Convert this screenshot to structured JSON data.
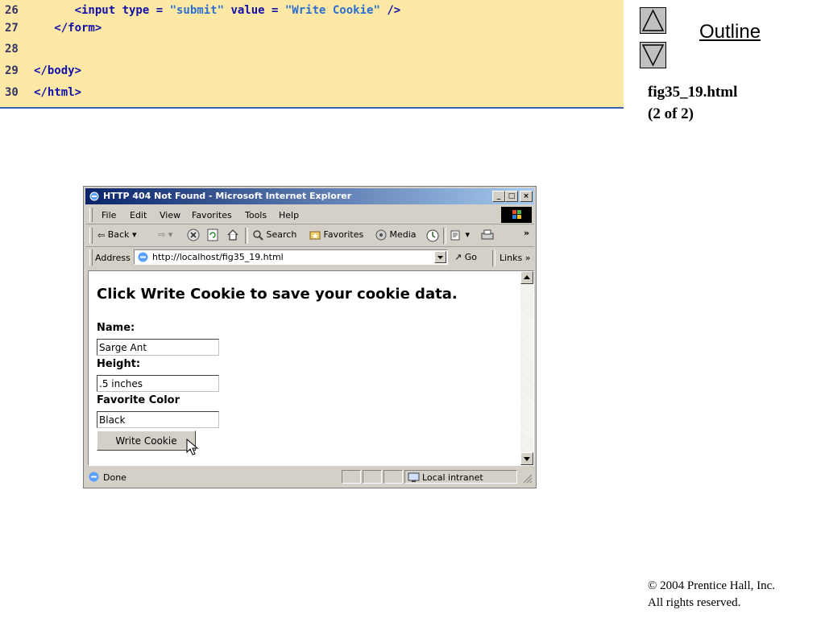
{
  "code": {
    "lines": [
      {
        "num": "26",
        "pre": "      <input type = ",
        "s1": "\"submit\"",
        "mid": " value = ",
        "s2": "\"Write Cookie\"",
        "post": " />"
      },
      {
        "num": "27",
        "text": "   </form>"
      },
      {
        "num": "28",
        "text": ""
      },
      {
        "num": "29",
        "text": "</body>"
      },
      {
        "num": "30",
        "text": "</html>"
      }
    ]
  },
  "outline": {
    "label": "Outline",
    "caption_line1": "fig35_19.html",
    "caption_line2": "(2 of 2)"
  },
  "footer": {
    "copyright_line1": "© 2004 Prentice Hall, Inc.",
    "copyright_line2": "All rights reserved."
  },
  "browser": {
    "title": "HTTP 404 Not Found - Microsoft Internet Explorer",
    "menu": [
      "File",
      "Edit",
      "View",
      "Favorites",
      "Tools",
      "Help"
    ],
    "toolbar": {
      "back": "Back",
      "search": "Search",
      "favorites": "Favorites",
      "media": "Media",
      "more": "»"
    },
    "address_label": "Address",
    "address_value": "http://localhost/fig35_19.html",
    "go_label": "Go",
    "links_label": "Links »",
    "status_text": "Done",
    "zone_text": "Local intranet"
  },
  "page": {
    "heading": "Click Write Cookie to save your cookie data.",
    "name_label": "Name:",
    "name_value": "Sarge Ant",
    "height_label": "Height:",
    "height_value": ".5 inches",
    "color_label": "Favorite Color",
    "color_value": "Black",
    "button_label": "Write Cookie"
  },
  "colors": {
    "code_background": "#fde8a6",
    "code_text": "#1111aa",
    "code_string": "#2a6fd0",
    "title_bar_start": "#0a246a",
    "title_bar_end": "#a6caf0"
  }
}
